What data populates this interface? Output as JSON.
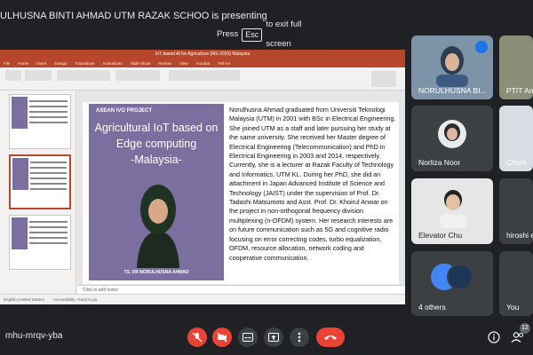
{
  "presenter_banner": "ULHUSNA BINTI AHMAD UTM RAZAK SCHOO is presenting",
  "fullscreen_hint": {
    "before": "Press",
    "key": "Esc",
    "after": "to exit full screen"
  },
  "ppt": {
    "title": "IoT based AI for Agriculture (MS-2023) Malaysia",
    "menu": [
      "File",
      "Home",
      "Insert",
      "Design",
      "Transitions",
      "Animations",
      "Slide Show",
      "Review",
      "View",
      "Acrobat",
      "Tell me"
    ],
    "notes_placeholder": "Click to add notes",
    "status": [
      "English (United States)",
      "Accessibility: Good to go"
    ]
  },
  "slide": {
    "tag": "ASEAN IVO PROJECT",
    "title": "Agricultural IoT based on Edge computing",
    "subtitle": "-Malaysia-",
    "presenter_caption": "TS. DR NORULHUSNA AHMAD",
    "bio": "Norulhusna Ahmad graduated from Universiti Teknologi Malaysia (UTM) in 2001 with BSc in Electrical Engineering. She joined UTM as a staff and later pursuing her study at the same university. She received her Master degree of Electrical Engineering (Telecommunication) and PhD in Electrical Engineering in 2003 and 2014, respectively. Currently, she is a lecturer at Razak Faculty of Technology and Informatics, UTM KL. During her PhD, she did an attachment in Japan Advanced Institute of Science and Technology (JAIST) under the supervision of Prof. Dr. Tadashi Matsumoto and Asst. Prof. Dr. Khoirul Anwar on the project in non-orthogonal frequency division multiplexing (n-OFDM) system. Her research interests are on future communication such as 5G and cognitive radio focusing on error correcting codes, turbo equalization, OFDM, resource allocation, network coding and cooperative communication."
  },
  "participants": [
    {
      "name": "NORULHUSNA BI..."
    },
    {
      "name": "PTIT Ano"
    },
    {
      "name": "Norliza Noor"
    },
    {
      "name": "Chom"
    },
    {
      "name": "Elevator Chu"
    },
    {
      "name": "hiroshi e"
    },
    {
      "name": "4 others"
    },
    {
      "name": "You"
    }
  ],
  "meeting_code": "mhu-mrqv-yba",
  "participant_count": "12",
  "colors": {
    "end_call": "#ea4335",
    "slide_purple": "#7b6fa0",
    "ppt_accent": "#b7472a",
    "speaking": "#1a73e8"
  }
}
